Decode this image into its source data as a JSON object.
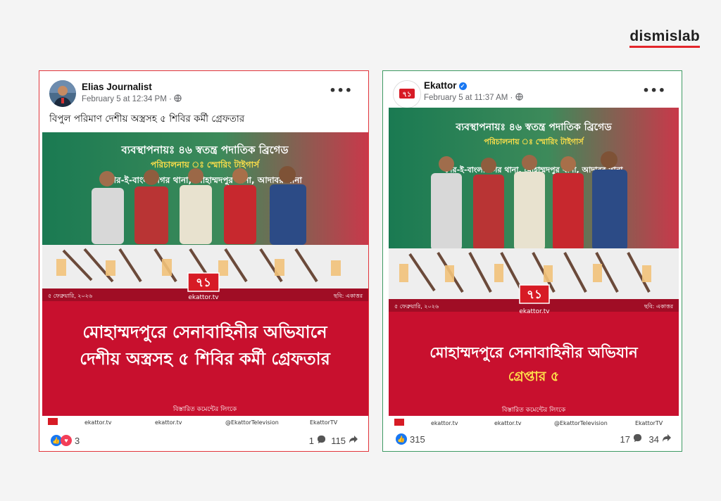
{
  "brand": {
    "name": "dismislab"
  },
  "posts": [
    {
      "author": "Elias Journalist",
      "timestamp": "February 5 at 12:34 PM",
      "privacy_icon": "globe-icon",
      "caption": "বিপুল পরিমাণ দেশীয় অস্ত্রসহ ৫ শিবির কর্মী গ্রেফতার",
      "image": {
        "banner_line1": "ব্যবস্থাপনায়ঃ ৪৬ স্বতন্ত্র পদাতিক ব্রিগেড",
        "banner_line2": "পরিচালনায় ঃ স্মোরিং টাইগার্স",
        "banner_line3": "শের-ই-বাংলা নগর থানা, মোহাম্মদপুর থানা, আদাবর থানা",
        "date": "৫ ফেব্রুয়ারি, ২০২৬",
        "credit": "ছবি: একাত্তর",
        "channel_logo": "৭১",
        "channel_url": "ekattor.tv",
        "headline1": "মোহাম্মদপুরে সেনাবাহিনীর অভিযানে",
        "headline2": "দেশীয় অস্ত্রসহ ৫ শিবির কর্মী গ্রেফতার",
        "footer_text": "বিস্তারিত কমেন্টের লিংকে",
        "social": [
          "ekattor.tv",
          "ekattor.tv",
          "@EkattorTelevision",
          "EkattorTV"
        ]
      },
      "reactions": "3",
      "comments": "1",
      "shares": "115"
    },
    {
      "author": "Ekattor",
      "timestamp": "February 5 at 11:37 AM",
      "privacy_icon": "globe-icon",
      "caption": "",
      "image": {
        "banner_line1": "ব্যবস্থাপনায়ঃ ৪৬ স্বতন্ত্র পদাতিক ব্রিগেড",
        "banner_line2": "পরিচালনায় ঃ স্মোরিং টাইগার্স",
        "banner_line3": "শের-ই-বাংলা নগর থানা, মোহাম্মদপুর থানা, আদাবর থানা",
        "date": "৫ ফেব্রুয়ারি, ২০২৬",
        "credit": "ছবি: একাত্তর",
        "channel_logo": "৭১",
        "channel_url": "ekattor.tv",
        "headline1": "মোহাম্মদপুরে সেনাবাহিনীর অভিযান",
        "headline2": "গ্রেপ্তার ৫",
        "footer_text": "বিস্তারিত কমেন্টের লিংকে",
        "social": [
          "ekattor.tv",
          "ekattor.tv",
          "@EkattorTelevision",
          "EkattorTV"
        ]
      },
      "reactions": "315",
      "comments": "17",
      "shares": "34"
    }
  ],
  "colors": {
    "accent_red": "#e3262b",
    "left_border": "#e1353b",
    "right_border": "#3e9a63",
    "facebook_blue": "#1877f2"
  }
}
